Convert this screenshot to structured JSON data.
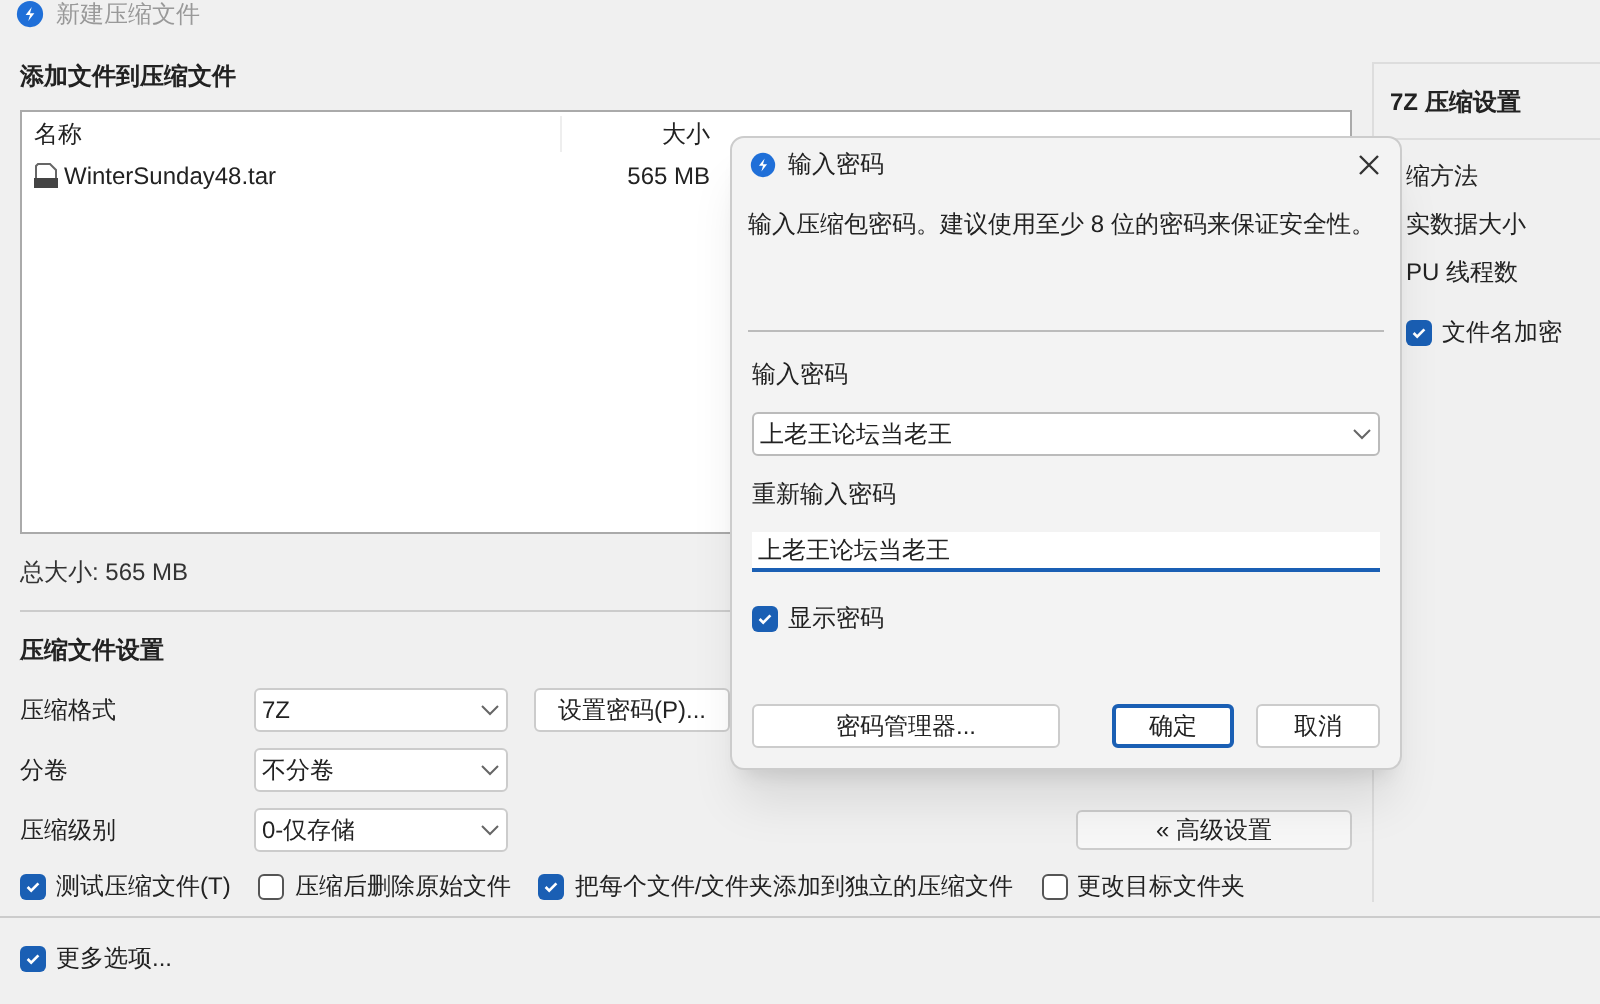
{
  "window": {
    "title": "新建压缩文件"
  },
  "files_section": {
    "title": "添加文件到压缩文件",
    "columns": [
      "名称",
      "大小"
    ],
    "rows": [
      {
        "name": "WinterSunday48.tar",
        "size": "565 MB"
      }
    ],
    "total": "总大小: 565 MB"
  },
  "settings": {
    "title": "压缩文件设置",
    "fields": [
      {
        "label": "压缩格式",
        "value": "7Z"
      },
      {
        "label": "分卷",
        "value": "不分卷"
      },
      {
        "label": "压缩级别",
        "value": "0-仅存储"
      }
    ],
    "password_button": "设置密码(P)...",
    "advanced_button": "« 高级设置",
    "options": [
      {
        "label": "测试压缩文件(T)",
        "checked": true
      },
      {
        "label": "压缩后删除原始文件",
        "checked": false
      },
      {
        "label": "把每个文件/文件夹添加到独立的压缩文件",
        "checked": true
      },
      {
        "label": "更改目标文件夹",
        "checked": false
      }
    ],
    "more": {
      "label": "更多选项...",
      "checked": true
    }
  },
  "side_panel": {
    "title": "7Z 压缩设置",
    "items": [
      "缩方法",
      "实数据大小",
      "PU 线程数"
    ],
    "encrypt": {
      "label": "文件名加密",
      "checked": true
    }
  },
  "dialog": {
    "title": "输入密码",
    "message": "输入压缩包密码。建议使用至少 8 位的密码来保证安全性。",
    "password_label": "输入密码",
    "password_value": "上老王论坛当老王",
    "confirm_label": "重新输入密码",
    "confirm_value": "上老王论坛当老王",
    "show_password": {
      "label": "显示密码",
      "checked": true
    },
    "buttons": [
      {
        "label": "密码管理器...",
        "kind": "secondary"
      },
      {
        "label": "确定",
        "kind": "primary"
      },
      {
        "label": "取消",
        "kind": "secondary"
      }
    ]
  }
}
